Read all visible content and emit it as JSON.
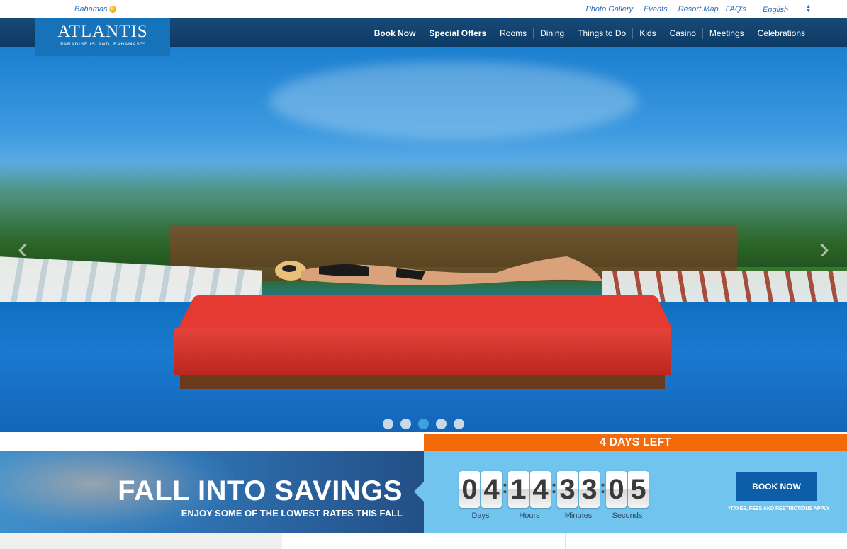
{
  "utility": {
    "region": "Bahamas",
    "links": [
      "Photo Gallery",
      "Events",
      "Resort Map",
      "FAQ's"
    ],
    "language": "English"
  },
  "logo": {
    "name": "ATLANTIS",
    "tagline": "PARADISE ISLAND, BAHAMAS™"
  },
  "nav": {
    "items": [
      "Book Now",
      "Special Offers",
      "Rooms",
      "Dining",
      "Things to Do",
      "Kids",
      "Casino",
      "Meetings",
      "Celebrations"
    ]
  },
  "hero": {
    "slide_count": 5,
    "active_slide": 3
  },
  "promo": {
    "days_left": "4 DAYS LEFT",
    "title": "FALL INTO SAVINGS",
    "subtitle": "ENJOY SOME OF THE LOWEST RATES THIS FALL",
    "countdown": {
      "days": "04",
      "hours": "14",
      "minutes": "33",
      "seconds": "05",
      "days_label": "Days",
      "hours_label": "Hours",
      "minutes_label": "Minutes",
      "seconds_label": "Seconds"
    },
    "book_now": "BOOK NOW",
    "fine_print": "*TAXES, FEES AND RESTRICTIONS APPLY"
  },
  "colors": {
    "nav_bg": "#164a78",
    "logo_bg": "#1672b9",
    "accent_orange": "#f26a09",
    "promo_light_blue": "#70c4ee",
    "button_blue": "#0d5ea8"
  }
}
